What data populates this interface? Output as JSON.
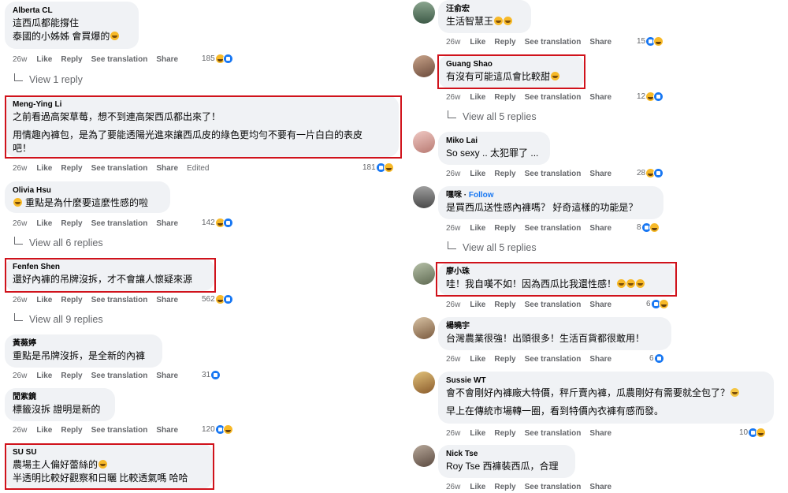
{
  "actions": {
    "like": "Like",
    "reply": "Reply",
    "translate": "See translation",
    "share": "Share",
    "edited": "Edited"
  },
  "left": [
    {
      "author": "Alberta CL",
      "lines": [
        "這西瓜都能撐住",
        "泰國的小姊姊 會買爆的"
      ],
      "time": "26w",
      "reactions": "185",
      "replies": "View 1 reply",
      "highlight": false
    },
    {
      "author": "Meng-Ying Li",
      "lines": [
        "之前看過高架草莓，想不到連高架西瓜都出來了！",
        "用情趣內褲包，是為了要能透陽光進來讓西瓜皮的綠色更均勻不要有一片白白的表皮",
        "吧！"
      ],
      "time": "26w",
      "reactions": "181",
      "edited": true,
      "highlight": true
    },
    {
      "author": "Olivia Hsu",
      "lines": [
        "重點是為什麼要這麼性感的啦"
      ],
      "time": "26w",
      "reactions": "142",
      "replies": "View all 6 replies",
      "highlight": false
    },
    {
      "author": "Fenfen Shen",
      "lines": [
        "還好內褲的吊牌沒拆，才不會讓人懷疑來源"
      ],
      "time": "26w",
      "reactions": "562",
      "replies": "View all 9 replies",
      "highlight": true
    },
    {
      "author": "黃薇婷",
      "lines": [
        "重點是吊牌沒拆，是全新的內褲"
      ],
      "time": "26w",
      "reactions": "31",
      "highlight": false
    },
    {
      "author": "閒紫鏡",
      "lines": [
        "標籤沒拆 證明是新的"
      ],
      "time": "26w",
      "reactions": "120",
      "highlight": false
    },
    {
      "author": "SU SU",
      "lines": [
        "農場主人偏好蕾絲的",
        "半透明比較好觀察和日曬 比較透氣嗎 哈哈"
      ],
      "highlight": true
    }
  ],
  "right": [
    {
      "author": "汪俞宏",
      "lines": [
        "生活智慧王"
      ],
      "time": "26w",
      "reactions": "15",
      "highlight": false
    },
    {
      "author": "Guang Shao",
      "lines": [
        "有沒有可能這瓜會比較甜"
      ],
      "time": "26w",
      "reactions": "12",
      "replies": "View all 5 replies",
      "highlight": true
    },
    {
      "author": "Miko Lai",
      "lines": [
        "So sexy .. 太犯罪了 ..."
      ],
      "time": "26w",
      "reactions": "28",
      "highlight": false
    },
    {
      "author": "嘿咪",
      "follow": "Follow",
      "lines": [
        "是買西瓜送性感內褲嗎？ 好奇這樣的功能是？"
      ],
      "time": "26w",
      "reactions": "8",
      "replies": "View all 5 replies",
      "highlight": false
    },
    {
      "author": "廖小珠",
      "lines": [
        "哇！我自嘆不如！因為西瓜比我還性感！"
      ],
      "time": "26w",
      "reactions": "6",
      "highlight": true
    },
    {
      "author": "楊曉宇",
      "lines": [
        "台灣農業很強！出頭很多！生活百貨都很敢用！"
      ],
      "time": "26w",
      "reactions": "6",
      "highlight": false
    },
    {
      "author": "Sussie WT",
      "lines": [
        "會不會剛好內褲廠大特價，秤斤賣內褲，瓜農剛好有需要就全包了？",
        "早上在傳統市場轉一圈，看到特價內衣褲有感而發。"
      ],
      "time": "26w",
      "reactions": "10",
      "highlight": false
    },
    {
      "author": "Nick Tse",
      "lines": [
        "Roy Tse 西褲裝西瓜，合理"
      ],
      "time": "26w",
      "highlight": false
    }
  ]
}
